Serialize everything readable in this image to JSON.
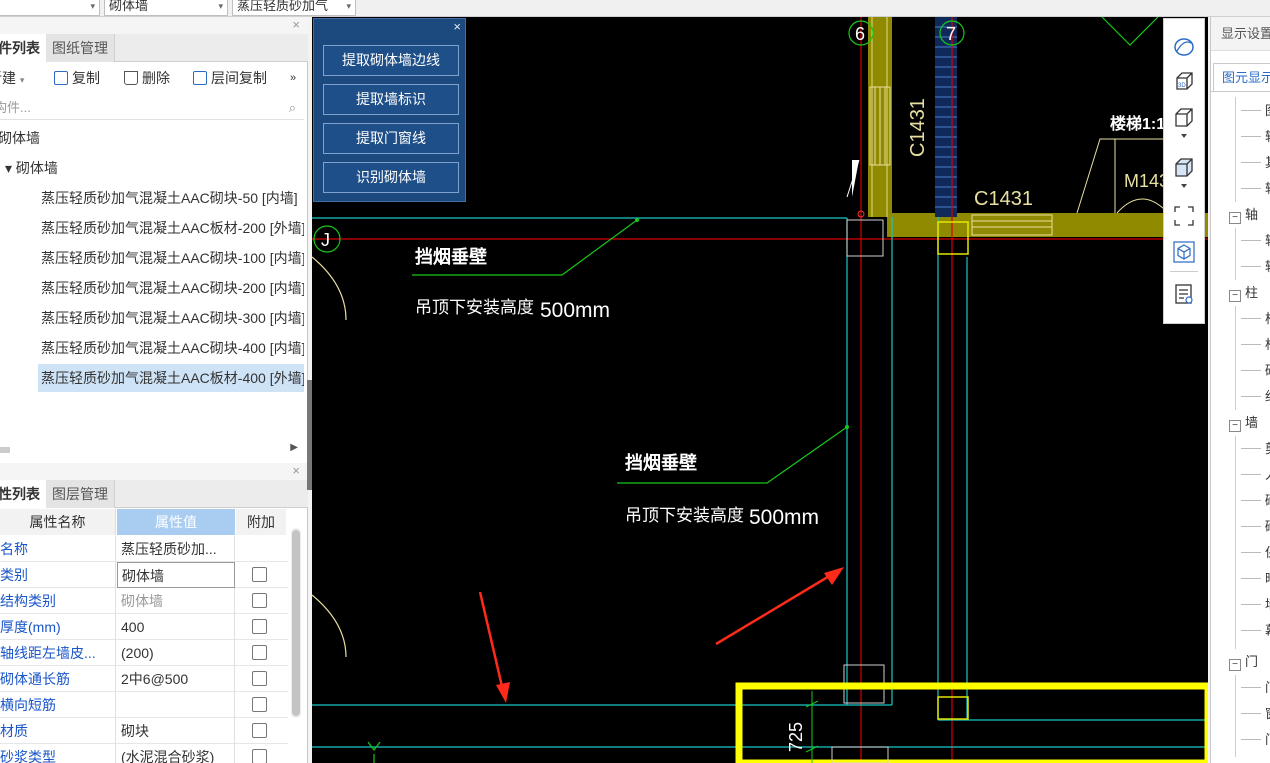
{
  "topbar": {
    "combo1": "",
    "combo2": "砌体墙",
    "combo3": "蒸压轻质砂加气"
  },
  "component_panel": {
    "close": "×",
    "tabs": [
      "构件列表",
      "图纸管理"
    ],
    "tab_visible": [
      "件列表",
      "图纸管理"
    ],
    "toolbar": {
      "new": "新建",
      "copy": "复制",
      "delete": "删除",
      "floor_copy": "层间复制",
      "more": "»"
    },
    "search_placeholder": "搜索构件...",
    "search_visible": "构件...",
    "tree": [
      {
        "label": "砌体墙",
        "level": 0
      },
      {
        "label": "▾ 砌体墙",
        "level": 1
      },
      {
        "label": "蒸压轻质砂加气混凝土AAC砌块-50 [内墙]",
        "level": 2
      },
      {
        "label": "蒸压轻质砂加气混凝土AAC板材-200 [外墙]",
        "level": 2
      },
      {
        "label": "蒸压轻质砂加气混凝土AAC砌块-100 [内墙]",
        "level": 2
      },
      {
        "label": "蒸压轻质砂加气混凝土AAC砌块-200 [内墙]",
        "level": 2
      },
      {
        "label": "蒸压轻质砂加气混凝土AAC砌块-300 [内墙]",
        "level": 2
      },
      {
        "label": "蒸压轻质砂加气混凝土AAC砌块-400 [内墙]",
        "level": 2
      },
      {
        "label": "蒸压轻质砂加气混凝土AAC板材-400 [外墙]",
        "level": 2,
        "selected": true
      }
    ]
  },
  "property_panel": {
    "close": "×",
    "tabs": [
      "属性列表",
      "图层管理"
    ],
    "tab_visible": [
      "性列表",
      "图层管理"
    ],
    "headers": [
      "属性名称",
      "属性值",
      "附加"
    ],
    "rows": [
      {
        "name": "名称",
        "value": "蒸压轻质砂加...",
        "has_check": false
      },
      {
        "name": "类别",
        "value": "砌体墙",
        "has_check": true,
        "boxed": true
      },
      {
        "name": "结构类别",
        "value": "砌体墙",
        "has_check": true,
        "gray": true
      },
      {
        "name": "厚度(mm)",
        "value": "400",
        "has_check": true
      },
      {
        "name": "轴线距左墙皮...",
        "value": "(200)",
        "has_check": true
      },
      {
        "name": "砌体通长筋",
        "value": "2中6@500",
        "has_check": true
      },
      {
        "name": "横向短筋",
        "value": "",
        "has_check": true
      },
      {
        "name": "材质",
        "value": "砌块",
        "has_check": true
      },
      {
        "name": "砂浆类型",
        "value": "(水泥混合砂浆)",
        "has_check": true
      }
    ]
  },
  "command_panel": {
    "close": "×",
    "buttons": [
      "提取砌体墙边线",
      "提取墙标识",
      "提取门窗线",
      "识别砌体墙"
    ]
  },
  "drawing": {
    "axis_labels": [
      "6",
      "7",
      "J"
    ],
    "text1_title": "挡烟垂壁",
    "text1_sub": "吊顶下安装高度",
    "text1_value": "500mm",
    "text2_title": "挡烟垂壁",
    "text2_sub": "吊顶下安装高度",
    "text2_value": "500mm",
    "window_vertical": "C1431",
    "window_horizontal": "C1431",
    "door_label": "M143",
    "scale_label": "楼梯1:1",
    "dim_725": "725",
    "colors": {
      "background": "#000000",
      "axis": "#d60000",
      "wall_outline": "#19c6c6",
      "leader": "#17c81a",
      "wall_fill": "#8f8a00",
      "highlight": "#ffff00",
      "annotation_arrow": "#ff2a1a"
    }
  },
  "view_toolbar": {
    "icons": [
      "orbit-icon",
      "3d-view-icon",
      "view-cube-icon",
      "shaded-box-icon",
      "zoom-extents-icon",
      "isometric-icon",
      "display-settings-icon"
    ]
  },
  "display_panel": {
    "title": "显示设置",
    "tab": "图元显示",
    "rows": [
      {
        "kind": "line",
        "label": "图"
      },
      {
        "kind": "line",
        "label": "轴"
      },
      {
        "kind": "line",
        "label": "其"
      },
      {
        "kind": "line",
        "label": "轴"
      },
      {
        "kind": "sec",
        "label": "轴"
      },
      {
        "kind": "line",
        "label": "轴"
      },
      {
        "kind": "line",
        "label": "轴"
      },
      {
        "kind": "sec",
        "label": "柱"
      },
      {
        "kind": "line",
        "label": "柱"
      },
      {
        "kind": "line",
        "label": "构"
      },
      {
        "kind": "line",
        "label": "砼"
      },
      {
        "kind": "line",
        "label": "约"
      },
      {
        "kind": "sec",
        "label": "墙"
      },
      {
        "kind": "line",
        "label": "剪"
      },
      {
        "kind": "line",
        "label": "人"
      },
      {
        "kind": "line",
        "label": "砌"
      },
      {
        "kind": "line",
        "label": "砌"
      },
      {
        "kind": "line",
        "label": "保"
      },
      {
        "kind": "line",
        "label": "暗"
      },
      {
        "kind": "line",
        "label": "墙"
      },
      {
        "kind": "line",
        "label": "幕"
      },
      {
        "kind": "sec",
        "label": "门"
      },
      {
        "kind": "line",
        "label": "门"
      },
      {
        "kind": "line",
        "label": "窗"
      },
      {
        "kind": "line",
        "label": "门"
      }
    ]
  }
}
